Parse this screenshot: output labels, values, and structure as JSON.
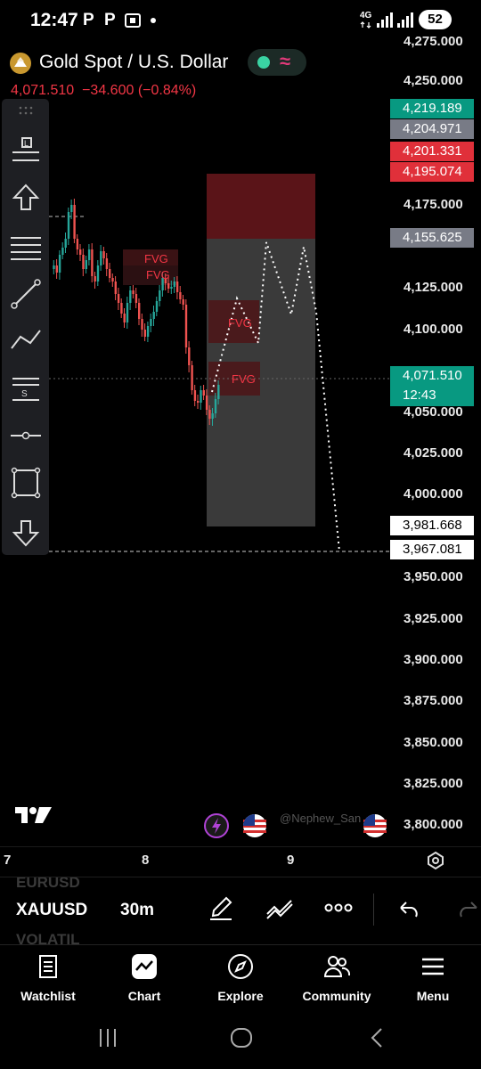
{
  "status_bar": {
    "time": "12:47",
    "icons": [
      "p-icon",
      "p-icon",
      "screenshot-icon",
      "dot-icon"
    ],
    "network": "4G",
    "battery": "52"
  },
  "header": {
    "symbol_title": "Gold Spot / U.S. Dollar",
    "last_price": "4,071.510",
    "change": "−34.600",
    "change_pct": "(−0.84%)"
  },
  "price_axis": {
    "ticks": [
      "4,275.000",
      "4,250.000",
      "4,175.000",
      "4,125.000",
      "4,100.000",
      "4,050.000",
      "4,025.000",
      "4,000.000",
      "3,950.000",
      "3,925.000",
      "3,900.000",
      "3,875.000",
      "3,850.000",
      "3,825.000",
      "3,800.000"
    ],
    "tags": {
      "tp_upper": "4,219.189",
      "gray_1": "4,204.971",
      "red_1": "4,201.331",
      "red_2": "4,195.074",
      "gray_2": "4,155.625",
      "current_price": "4,071.510",
      "countdown": "12:43",
      "white_1": "3,981.668",
      "white_2": "3,967.081"
    }
  },
  "chart": {
    "fvg_labels": [
      "FVG",
      "FVG",
      "FVG",
      "FVG"
    ],
    "watermark": "@Nephew_San",
    "colors": {
      "up": "#26a69a",
      "down": "#ef5350",
      "fvg_text": "#f23645",
      "stop_zone": "#5a1418",
      "target_zone": "#3a3a3a",
      "current_tag": "#089981"
    }
  },
  "time_axis": {
    "labels": [
      "7",
      "8",
      "9"
    ]
  },
  "toolbar": {
    "tools": [
      "drag-handle-icon",
      "horizontal-line-icon",
      "arrow-up-icon",
      "parallel-lines-icon",
      "trend-line-icon",
      "polyline-icon",
      "signal-lines-icon",
      "horizontal-ray-icon",
      "rectangle-icon",
      "arrow-down-icon"
    ]
  },
  "ticker_row": {
    "ghost_above": "EURUSD",
    "symbol": "XAUUSD",
    "interval": "30m",
    "ghost_below": "VOLATIL"
  },
  "bottom_nav": {
    "items": [
      {
        "label": "Watchlist",
        "icon": "watchlist-icon"
      },
      {
        "label": "Chart",
        "icon": "chart-icon"
      },
      {
        "label": "Explore",
        "icon": "compass-icon"
      },
      {
        "label": "Community",
        "icon": "people-icon"
      },
      {
        "label": "Menu",
        "icon": "menu-icon"
      }
    ]
  }
}
